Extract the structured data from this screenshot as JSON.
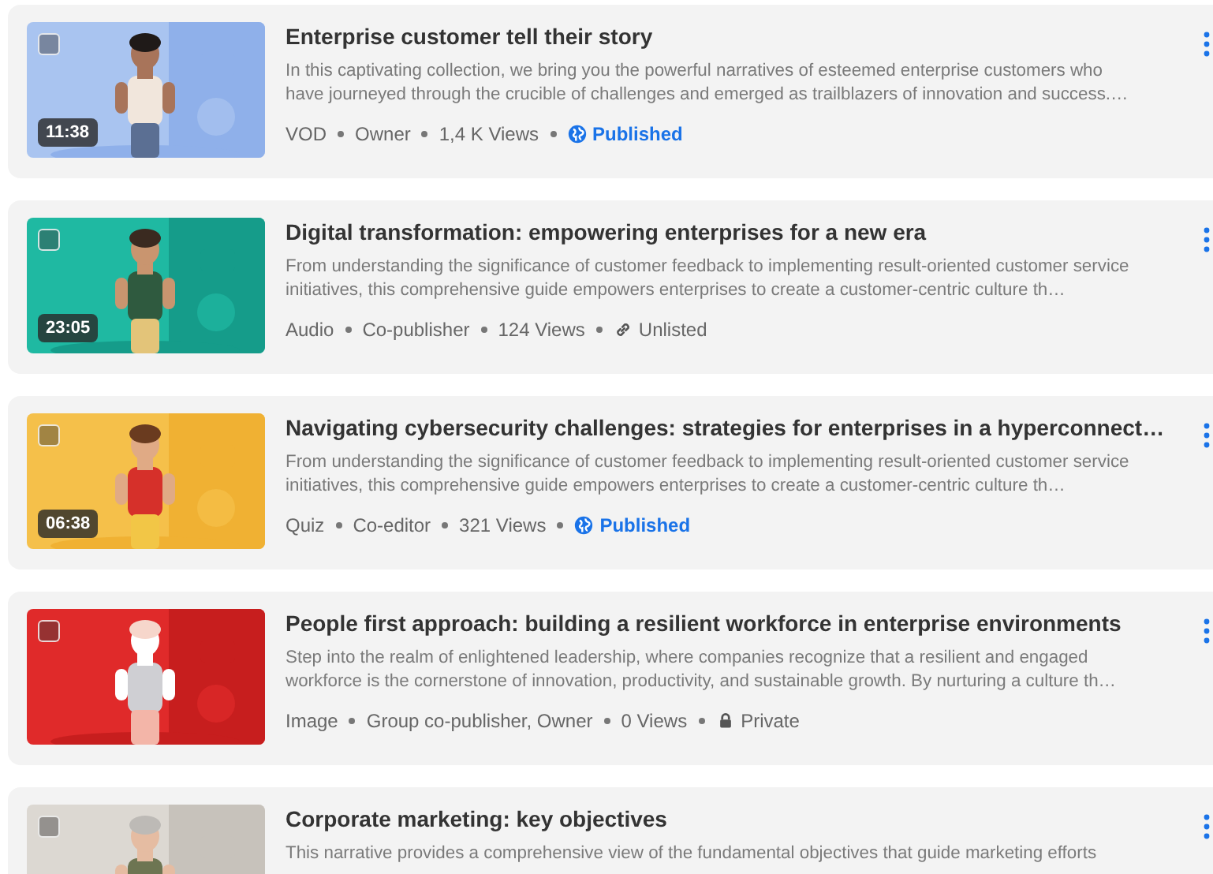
{
  "items": [
    {
      "title": "Enterprise customer tell their story",
      "description": "In this captivating collection, we bring you the powerful narratives of esteemed enterprise customers who have journeyed through the crucible of challenges and emerged as trailblazers of innovation and success.…",
      "duration": "11:38",
      "selected": false,
      "type": "VOD",
      "role": "Owner",
      "views": "1,4 K Views",
      "status": {
        "kind": "published",
        "label": "Published"
      }
    },
    {
      "title": "Digital transformation: empowering enterprises for a new era",
      "description": "From understanding the significance of customer feedback to implementing result-oriented customer service initiatives, this comprehensive guide empowers enterprises to create a customer-centric culture th…",
      "duration": "23:05",
      "selected": false,
      "type": "Audio",
      "role": "Co-publisher",
      "views": "124 Views",
      "status": {
        "kind": "unlisted",
        "label": "Unlisted"
      }
    },
    {
      "title": "Navigating cybersecurity challenges: strategies for enterprises in a hyperconnect…",
      "description": "From understanding the significance of customer feedback to implementing result-oriented customer service initiatives, this comprehensive guide empowers enterprises to create a customer-centric culture th…",
      "duration": "06:38",
      "selected": false,
      "type": "Quiz",
      "role": "Co-editor",
      "views": "321 Views",
      "status": {
        "kind": "published",
        "label": "Published"
      }
    },
    {
      "title": "People first approach: building a resilient workforce in enterprise environments",
      "description": "Step into the realm of enlightened leadership, where companies recognize that a resilient and engaged workforce is the cornerstone of innovation, productivity, and sustainable growth. By nurturing a culture th…",
      "selected": false,
      "type": "Image",
      "role": "Group co-publisher, Owner",
      "views": "0 Views",
      "status": {
        "kind": "private",
        "label": "Private"
      }
    },
    {
      "title": "Corporate marketing: key objectives",
      "description": "This narrative provides a comprehensive view of the fundamental objectives that guide marketing efforts",
      "selected": false
    }
  ]
}
